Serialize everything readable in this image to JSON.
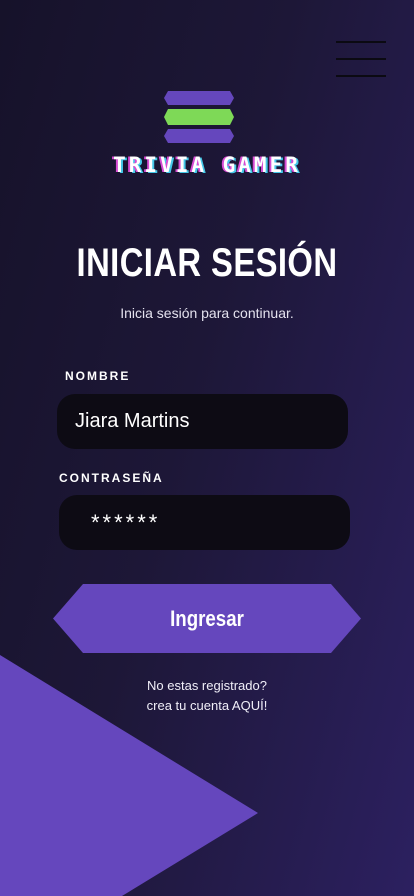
{
  "brand": {
    "name": "TRIVIA GAMER",
    "logo_icon": "hexagon-stack-logo",
    "colors": {
      "purple": "#6547bd",
      "green": "#7ed957"
    }
  },
  "menu": {
    "icon": "hamburger-menu-icon"
  },
  "header": {
    "title": "INICIAR SESIÓN",
    "subtitle": "Inicia sesión para continuar."
  },
  "form": {
    "name_label": "NOMBRE",
    "name_value": "Jiara Martins",
    "password_label": "CONTRASEÑA",
    "password_value": "******",
    "submit_label": "Ingresar"
  },
  "register": {
    "line1": "No estas registrado?",
    "line2": "crea tu cuenta AQUÍ!"
  },
  "theme": {
    "accent": "#6547bd",
    "field_bg": "#0d0b14"
  }
}
